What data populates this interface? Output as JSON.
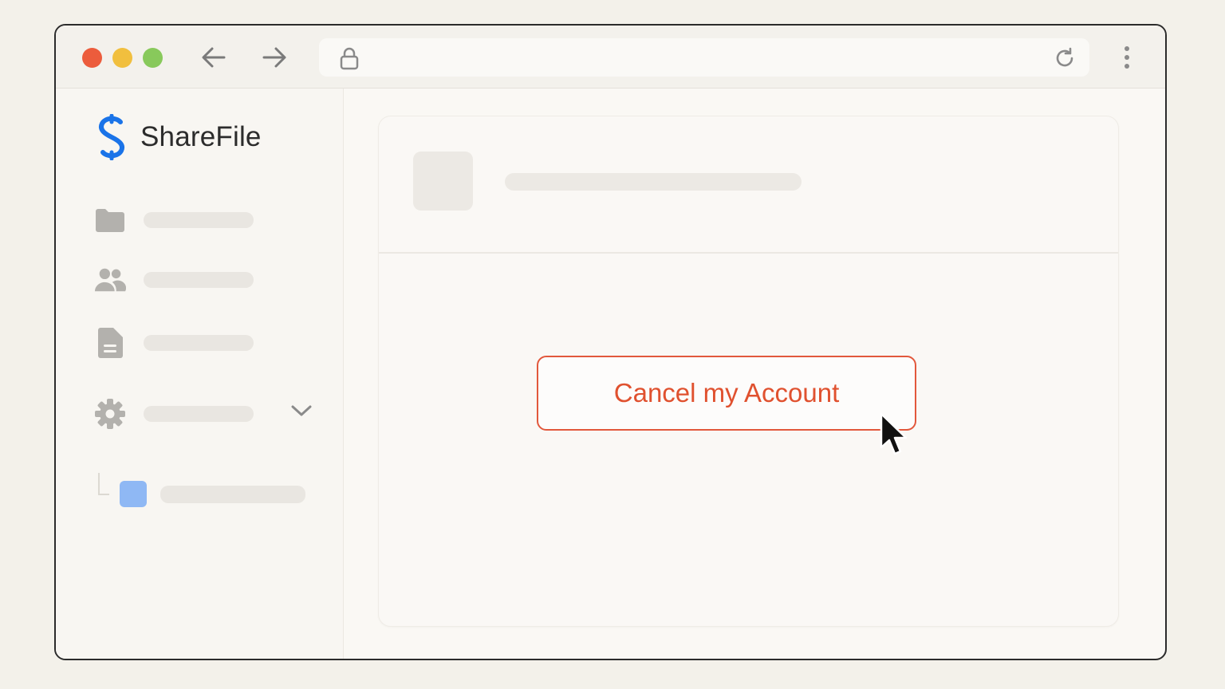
{
  "browser": {
    "controls": {
      "close_color": "#ec5c3c",
      "minimize_color": "#f1bf3e",
      "maximize_color": "#88c95b"
    },
    "icons": {
      "back": "back-arrow-icon",
      "forward": "forward-arrow-icon",
      "lock": "lock-icon",
      "reload": "reload-icon",
      "menu": "kebab-menu-icon"
    },
    "address": ""
  },
  "sidebar": {
    "brand": {
      "name": "ShareFile",
      "logo": "sharefile-logo-icon",
      "logo_color": "#1a73e8"
    },
    "items": [
      {
        "icon": "folder-icon"
      },
      {
        "icon": "users-icon"
      },
      {
        "icon": "document-icon"
      },
      {
        "icon": "gear-icon",
        "expandable": true
      }
    ],
    "sub_item": {
      "color": "#8fb8f4"
    }
  },
  "main": {
    "cancel_button_label": "Cancel my Account",
    "accent": "#e0512f"
  }
}
